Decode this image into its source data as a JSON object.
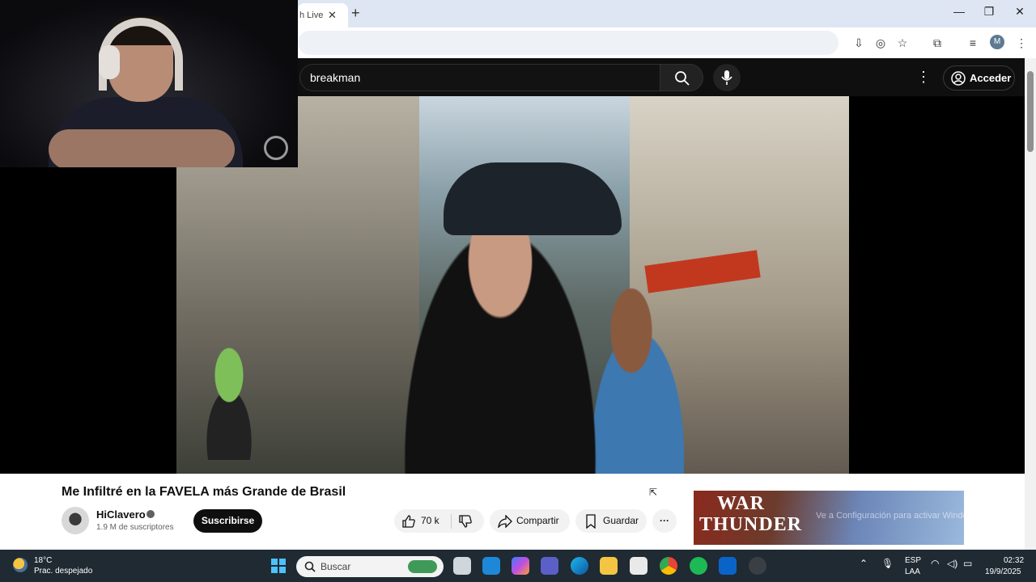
{
  "browser": {
    "tab_label": "h Live",
    "tab_close": "✕",
    "new_tab": "+",
    "profile_initial": "M",
    "window": {
      "minimize": "—",
      "restore": "❐",
      "close": "✕"
    }
  },
  "youtube": {
    "search_value": "breakman",
    "signin_label": "Acceder",
    "video": {
      "title": "Me Infiltré en la FAVELA más Grande de Brasil",
      "channel": "HiClavero",
      "subscribers": "1.9 M de suscriptores",
      "subscribe_label": "Suscribirse",
      "likes": "70 k",
      "share_label": "Compartir",
      "save_label": "Guardar",
      "more": "···"
    },
    "ad": {
      "line1": "WAR",
      "line2": "THUNDER"
    },
    "watermark": "Ve a Configuración para activar Windows."
  },
  "taskbar": {
    "temperature": "18°C",
    "condition": "Prac. despejado",
    "search_placeholder": "Buscar",
    "lang_top": "ESP",
    "lang_bottom": "LAA",
    "time": "02:32",
    "date": "19/9/2025"
  },
  "colors": {
    "accent": "#0f0f0f",
    "taskbar": "#1f2a33"
  }
}
